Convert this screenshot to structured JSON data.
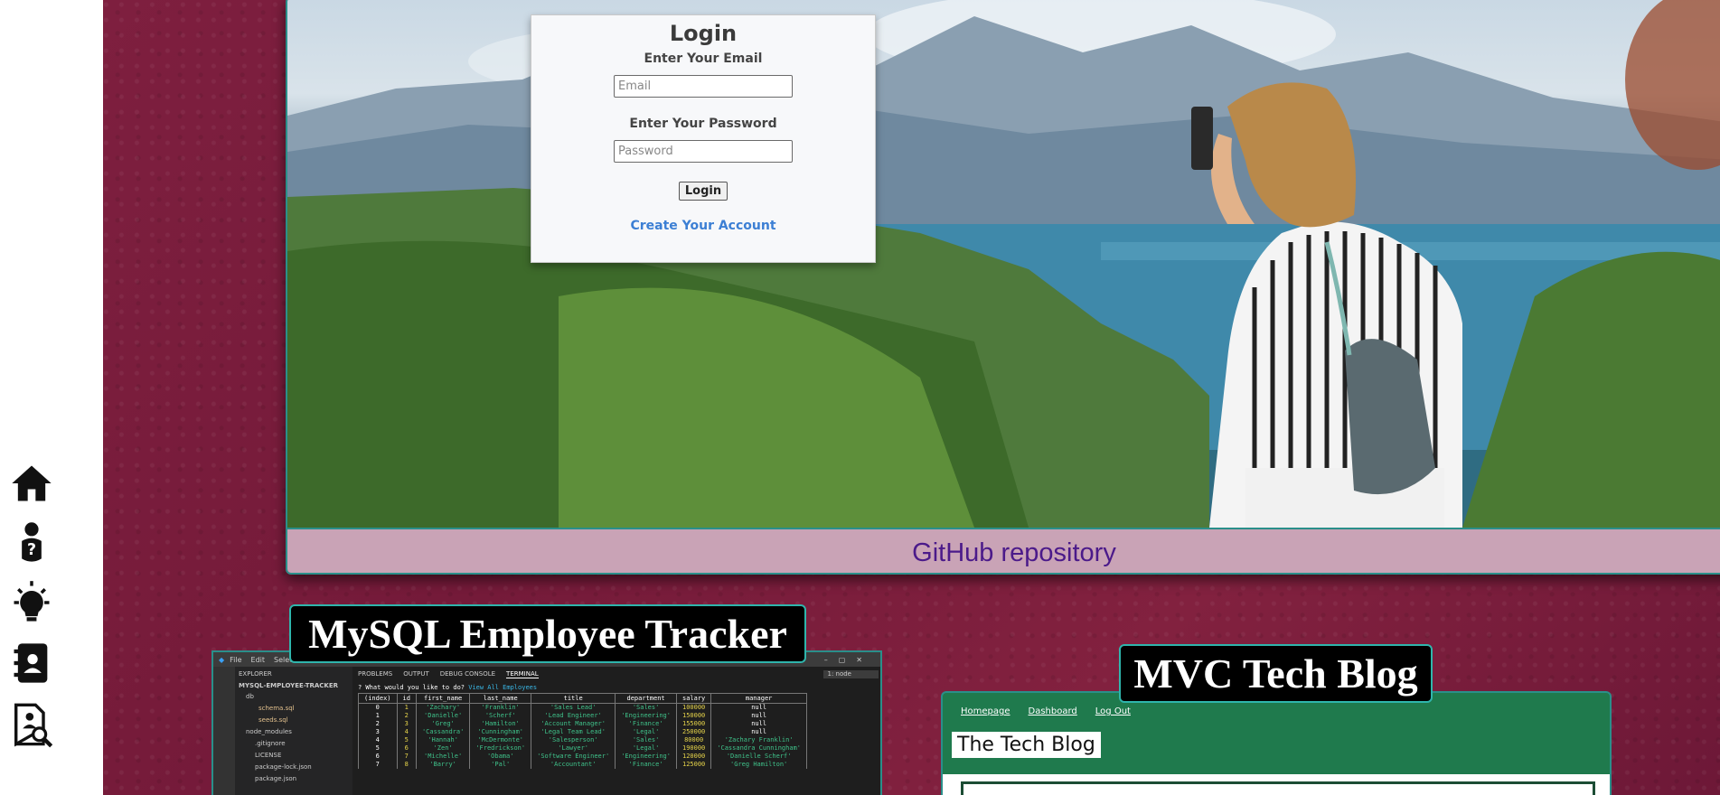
{
  "sidenav": {
    "items": [
      {
        "name": "home-icon"
      },
      {
        "name": "about-person-icon"
      },
      {
        "name": "lightbulb-projects-icon"
      },
      {
        "name": "contact-card-icon"
      },
      {
        "name": "resume-search-icon"
      }
    ]
  },
  "hero": {
    "caption": "GitHub repository",
    "login": {
      "title": "Login",
      "email_label": "Enter Your Email",
      "email_placeholder": "Email",
      "password_label": "Enter Your Password",
      "password_placeholder": "Password",
      "button": "Login",
      "create_link": "Create Your Account"
    }
  },
  "projects": [
    {
      "title": "MySQL Employee Tracker"
    },
    {
      "title": "MVC Tech Blog"
    }
  ],
  "vscode": {
    "menu": [
      "File",
      "Edit",
      "Selec"
    ],
    "explorer_title": "EXPLORER",
    "project_folder": "MYSQL-EMPLOYEE-TRACKER",
    "files": [
      "db",
      "schema.sql",
      "seeds.sql",
      "node_modules",
      ".gitignore",
      "LICENSE",
      "package-lock.json",
      "package.json"
    ],
    "panel_tabs": [
      "PROBLEMS",
      "OUTPUT",
      "DEBUG CONSOLE",
      "TERMINAL"
    ],
    "terminal_select": "1: node",
    "prompt": "? What would you like to do?",
    "prompt_answer": "View All Employees",
    "table_headers": [
      "(index)",
      "id",
      "first_name",
      "last_name",
      "title",
      "department",
      "salary",
      "manager"
    ],
    "rows": [
      [
        "0",
        "1",
        "'Zachary'",
        "'Franklin'",
        "'Sales Lead'",
        "'Sales'",
        "100000",
        "null"
      ],
      [
        "1",
        "2",
        "'Danielle'",
        "'Scherf'",
        "'Lead Engineer'",
        "'Engineering'",
        "150000",
        "null"
      ],
      [
        "2",
        "3",
        "'Greg'",
        "'Hamilton'",
        "'Account Manager'",
        "'Finance'",
        "155000",
        "null"
      ],
      [
        "3",
        "4",
        "'Cassandra'",
        "'Cunningham'",
        "'Legal Team Lead'",
        "'Legal'",
        "250000",
        "null"
      ],
      [
        "4",
        "5",
        "'Hannah'",
        "'McDermonte'",
        "'Salesperson'",
        "'Sales'",
        "80000",
        "'Zachary Franklin'"
      ],
      [
        "5",
        "6",
        "'Zen'",
        "'Fredrickson'",
        "'Lawyer'",
        "'Legal'",
        "190000",
        "'Cassandra Cunningham'"
      ],
      [
        "6",
        "7",
        "'Michelle'",
        "'Obama'",
        "'Software Engineer'",
        "'Engineering'",
        "120000",
        "'Danielle Scherf'"
      ],
      [
        "7",
        "8",
        "'Barry'",
        "'Pal'",
        "'Accountant'",
        "'Finance'",
        "125000",
        "'Greg Hamilton'"
      ]
    ]
  },
  "techblog": {
    "nav": [
      "Homepage",
      "Dashboard",
      "Log Out"
    ],
    "heading": "The Tech Blog"
  },
  "colors": {
    "maroon_bg": "#7b1e3d",
    "teal_border": "#2a8f8a",
    "caption_bg": "#c9a3b6",
    "caption_link": "#4b1a8a",
    "tech_green": "#1f7a4d"
  }
}
